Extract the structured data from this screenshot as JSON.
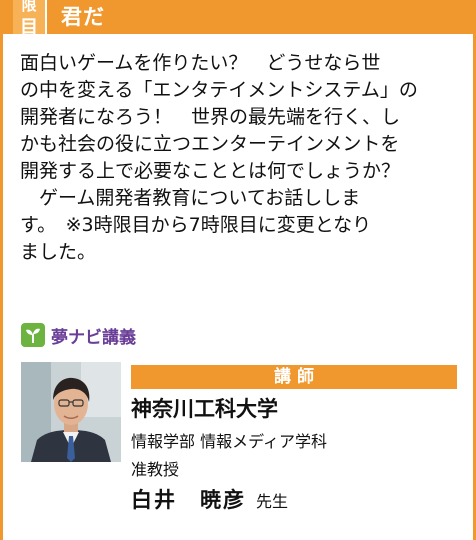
{
  "header": {
    "period_top": "限",
    "period_bottom": "目",
    "title": "君だ"
  },
  "description": "面白いゲームを作りたい？　どうせなら世\nの中を変える「エンタテイメントシステム」の\n開発者になろう！　世界の最先端を行く、し\nかも社会の役に立つエンターテインメントを\n開発する上で必要なこととは何でしょうか？\n　ゲーム開発者教育についてお話ししま\nす。　※3時限目から7時限目に変更となり\nました。",
  "yume_navi": {
    "icon": "sprout-icon",
    "label": "夢ナビ講義"
  },
  "lecturer": {
    "header": "講 師",
    "university": "神奈川工科大学",
    "department": "情報学部 情報メディア学科",
    "position": "准教授",
    "name": "白井　暁彦",
    "honorific": "先生"
  },
  "colors": {
    "accent": "#f0982e",
    "yume_purple": "#6a3e97",
    "icon_green": "#6db33f"
  }
}
